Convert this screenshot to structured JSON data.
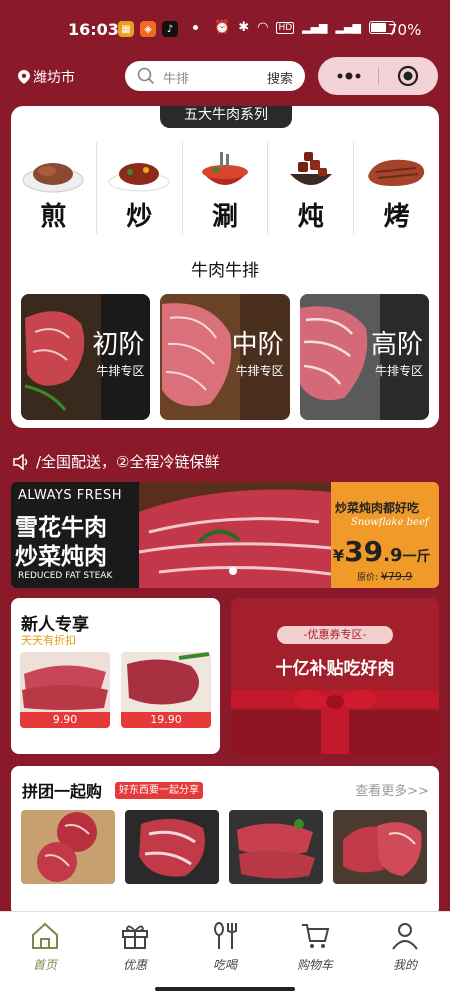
{
  "status_bar": {
    "time": "16:03",
    "battery_pct": "70%",
    "battery_level": 0.7,
    "network_label": "4G",
    "network_label2": "5G"
  },
  "header": {
    "location": "潍坊市",
    "search_placeholder": "牛排",
    "search_button": "搜索"
  },
  "categories": {
    "section_tag": "五大牛肉系列",
    "items": [
      {
        "label": "煎",
        "icon": "pan-steak-icon"
      },
      {
        "label": "炒",
        "icon": "stir-fry-icon"
      },
      {
        "label": "涮",
        "icon": "hotpot-icon"
      },
      {
        "label": "炖",
        "icon": "stew-icon"
      },
      {
        "label": "烤",
        "icon": "grill-icon"
      }
    ]
  },
  "steak": {
    "title": "牛肉牛排",
    "levels": [
      {
        "name": "初阶",
        "sub": "牛排专区"
      },
      {
        "name": "中阶",
        "sub": "牛排专区"
      },
      {
        "name": "高阶",
        "sub": "牛排专区"
      }
    ]
  },
  "notice": {
    "text": "​​/全国配送，②全程冷链保鲜",
    "display": "/全国配送，②全程冷链保鲜"
  },
  "banner": {
    "en_top": "ALWAYS FRESH",
    "line1": "雪花牛肉",
    "line2": "炒菜炖肉",
    "en_bottom": "REDUCED FAT STEAK",
    "promo_title": "炒菜炖肉都好吃",
    "promo_script": "Snowflake beef",
    "price_currency": "¥",
    "price_int": "39",
    "price_dec": ".9",
    "price_unit": "一斤",
    "orig_label": "原价:",
    "orig_price": "¥79.9"
  },
  "new_user": {
    "title": "新人专享",
    "subtitle": "天天有折扣",
    "items": [
      {
        "price": "9.90"
      },
      {
        "price": "19.90"
      }
    ]
  },
  "coupon": {
    "tag": "-优惠券专区-",
    "main": "十亿补贴吃好肉"
  },
  "group_buy": {
    "title": "拼团一起购",
    "badge": "好东西要一起分享",
    "more": "查看更多>>"
  },
  "tabbar": {
    "tabs": [
      {
        "label": "首页",
        "icon": "home-icon",
        "active": true
      },
      {
        "label": "优惠",
        "icon": "gift-icon",
        "active": false
      },
      {
        "label": "吃喝",
        "icon": "utensils-icon",
        "active": false
      },
      {
        "label": "购物车",
        "icon": "cart-icon",
        "active": false
      },
      {
        "label": "我的",
        "icon": "user-icon",
        "active": false
      }
    ]
  },
  "colors": {
    "brand_red": "#8a1a2a",
    "price_red": "#e63a3a",
    "promo_orange": "#f09a2a",
    "active_tab": "#7a8a48"
  }
}
